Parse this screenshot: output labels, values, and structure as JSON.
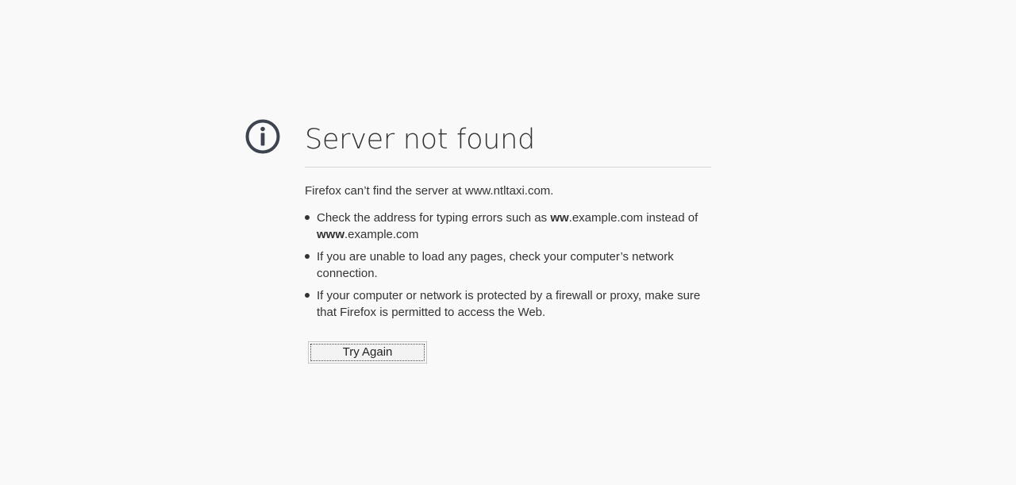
{
  "icon": {
    "name": "info-icon",
    "color": "#3d4450"
  },
  "title": "Server not found",
  "intro": "Firefox can’t find the server at www.ntltaxi.com.",
  "suggestions": [
    {
      "bold1": "",
      "pre": "Check the address for typing errors such as ",
      "strong_a": "ww",
      "mid": ".example.com instead of ",
      "strong_b": "www",
      "post": ".example.com"
    },
    {
      "text": "If you are unable to load any pages, check your computer’s network connection."
    },
    {
      "text": "If your computer or network is protected by a firewall or proxy, make sure that Firefox is permitted to access the Web."
    }
  ],
  "button": {
    "label": "Try Again"
  }
}
